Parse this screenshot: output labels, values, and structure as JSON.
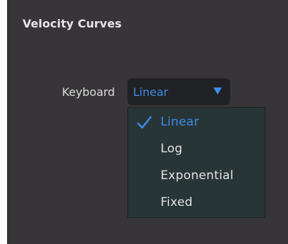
{
  "section": {
    "title": "Velocity Curves"
  },
  "keyboard_field": {
    "label": "Keyboard",
    "selected_value": "Linear",
    "arrow_icon": "triangle-down-icon"
  },
  "dropdown": {
    "items": [
      {
        "label": "Linear",
        "selected": true,
        "icon": "checkmark-icon"
      },
      {
        "label": "Log",
        "selected": false
      },
      {
        "label": "Exponential",
        "selected": false
      },
      {
        "label": "Fixed",
        "selected": false
      }
    ]
  },
  "colors": {
    "panel_background": "#373537",
    "accent": "#3d8de8",
    "dropdown_background": "#283537",
    "select_background": "#202124"
  }
}
